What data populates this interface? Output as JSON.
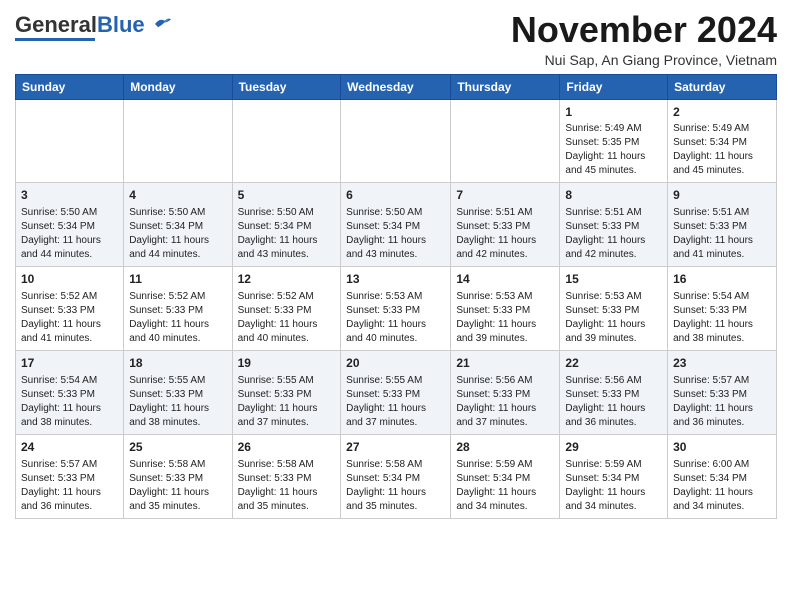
{
  "header": {
    "logo": {
      "general": "General",
      "blue": "Blue"
    },
    "month": "November 2024",
    "location": "Nui Sap, An Giang Province, Vietnam"
  },
  "weekdays": [
    "Sunday",
    "Monday",
    "Tuesday",
    "Wednesday",
    "Thursday",
    "Friday",
    "Saturday"
  ],
  "weeks": [
    [
      {
        "day": "",
        "content": ""
      },
      {
        "day": "",
        "content": ""
      },
      {
        "day": "",
        "content": ""
      },
      {
        "day": "",
        "content": ""
      },
      {
        "day": "",
        "content": ""
      },
      {
        "day": "1",
        "content": "Sunrise: 5:49 AM\nSunset: 5:35 PM\nDaylight: 11 hours and 45 minutes."
      },
      {
        "day": "2",
        "content": "Sunrise: 5:49 AM\nSunset: 5:34 PM\nDaylight: 11 hours and 45 minutes."
      }
    ],
    [
      {
        "day": "3",
        "content": "Sunrise: 5:50 AM\nSunset: 5:34 PM\nDaylight: 11 hours and 44 minutes."
      },
      {
        "day": "4",
        "content": "Sunrise: 5:50 AM\nSunset: 5:34 PM\nDaylight: 11 hours and 44 minutes."
      },
      {
        "day": "5",
        "content": "Sunrise: 5:50 AM\nSunset: 5:34 PM\nDaylight: 11 hours and 43 minutes."
      },
      {
        "day": "6",
        "content": "Sunrise: 5:50 AM\nSunset: 5:34 PM\nDaylight: 11 hours and 43 minutes."
      },
      {
        "day": "7",
        "content": "Sunrise: 5:51 AM\nSunset: 5:33 PM\nDaylight: 11 hours and 42 minutes."
      },
      {
        "day": "8",
        "content": "Sunrise: 5:51 AM\nSunset: 5:33 PM\nDaylight: 11 hours and 42 minutes."
      },
      {
        "day": "9",
        "content": "Sunrise: 5:51 AM\nSunset: 5:33 PM\nDaylight: 11 hours and 41 minutes."
      }
    ],
    [
      {
        "day": "10",
        "content": "Sunrise: 5:52 AM\nSunset: 5:33 PM\nDaylight: 11 hours and 41 minutes."
      },
      {
        "day": "11",
        "content": "Sunrise: 5:52 AM\nSunset: 5:33 PM\nDaylight: 11 hours and 40 minutes."
      },
      {
        "day": "12",
        "content": "Sunrise: 5:52 AM\nSunset: 5:33 PM\nDaylight: 11 hours and 40 minutes."
      },
      {
        "day": "13",
        "content": "Sunrise: 5:53 AM\nSunset: 5:33 PM\nDaylight: 11 hours and 40 minutes."
      },
      {
        "day": "14",
        "content": "Sunrise: 5:53 AM\nSunset: 5:33 PM\nDaylight: 11 hours and 39 minutes."
      },
      {
        "day": "15",
        "content": "Sunrise: 5:53 AM\nSunset: 5:33 PM\nDaylight: 11 hours and 39 minutes."
      },
      {
        "day": "16",
        "content": "Sunrise: 5:54 AM\nSunset: 5:33 PM\nDaylight: 11 hours and 38 minutes."
      }
    ],
    [
      {
        "day": "17",
        "content": "Sunrise: 5:54 AM\nSunset: 5:33 PM\nDaylight: 11 hours and 38 minutes."
      },
      {
        "day": "18",
        "content": "Sunrise: 5:55 AM\nSunset: 5:33 PM\nDaylight: 11 hours and 38 minutes."
      },
      {
        "day": "19",
        "content": "Sunrise: 5:55 AM\nSunset: 5:33 PM\nDaylight: 11 hours and 37 minutes."
      },
      {
        "day": "20",
        "content": "Sunrise: 5:55 AM\nSunset: 5:33 PM\nDaylight: 11 hours and 37 minutes."
      },
      {
        "day": "21",
        "content": "Sunrise: 5:56 AM\nSunset: 5:33 PM\nDaylight: 11 hours and 37 minutes."
      },
      {
        "day": "22",
        "content": "Sunrise: 5:56 AM\nSunset: 5:33 PM\nDaylight: 11 hours and 36 minutes."
      },
      {
        "day": "23",
        "content": "Sunrise: 5:57 AM\nSunset: 5:33 PM\nDaylight: 11 hours and 36 minutes."
      }
    ],
    [
      {
        "day": "24",
        "content": "Sunrise: 5:57 AM\nSunset: 5:33 PM\nDaylight: 11 hours and 36 minutes."
      },
      {
        "day": "25",
        "content": "Sunrise: 5:58 AM\nSunset: 5:33 PM\nDaylight: 11 hours and 35 minutes."
      },
      {
        "day": "26",
        "content": "Sunrise: 5:58 AM\nSunset: 5:33 PM\nDaylight: 11 hours and 35 minutes."
      },
      {
        "day": "27",
        "content": "Sunrise: 5:58 AM\nSunset: 5:34 PM\nDaylight: 11 hours and 35 minutes."
      },
      {
        "day": "28",
        "content": "Sunrise: 5:59 AM\nSunset: 5:34 PM\nDaylight: 11 hours and 34 minutes."
      },
      {
        "day": "29",
        "content": "Sunrise: 5:59 AM\nSunset: 5:34 PM\nDaylight: 11 hours and 34 minutes."
      },
      {
        "day": "30",
        "content": "Sunrise: 6:00 AM\nSunset: 5:34 PM\nDaylight: 11 hours and 34 minutes."
      }
    ]
  ]
}
